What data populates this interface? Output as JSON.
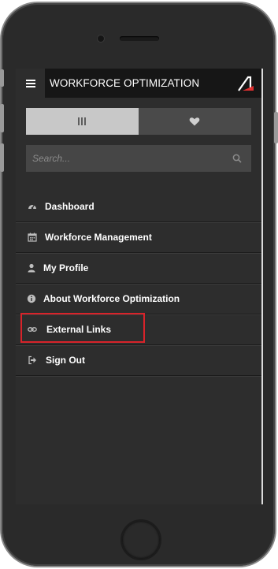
{
  "header": {
    "title": "WORKFORCE OPTIMIZATION"
  },
  "search": {
    "placeholder": "Search..."
  },
  "menu": {
    "items": [
      {
        "label": "Dashboard",
        "icon": "dashboard-icon"
      },
      {
        "label": "Workforce Management",
        "icon": "calendar-icon"
      },
      {
        "label": "My Profile",
        "icon": "user-icon"
      },
      {
        "label": "About Workforce Optimization",
        "icon": "info-icon"
      },
      {
        "label": "External Links",
        "icon": "link-icon"
      },
      {
        "label": "Sign Out",
        "icon": "sign-out-icon"
      }
    ]
  },
  "colors": {
    "highlight": "#d8232a",
    "accent_logo": "#e03030"
  }
}
